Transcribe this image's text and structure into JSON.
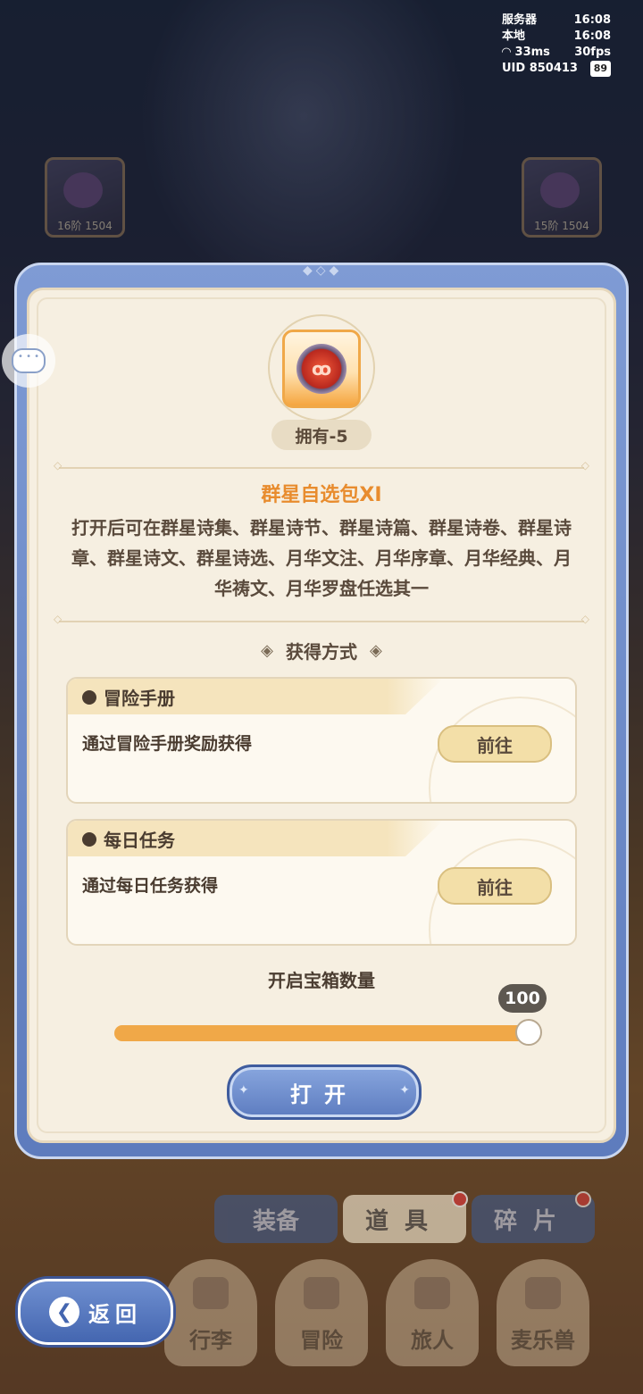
{
  "hud": {
    "server_label": "服务器",
    "server_time": "16:08",
    "local_label": "本地",
    "local_time": "16:08",
    "ping": "33ms",
    "fps": "30fps",
    "uid": "UID 850413",
    "battery": "89"
  },
  "relics": [
    {
      "stage": "16阶",
      "power": "1504"
    },
    {
      "stage": "15阶",
      "power": "1504"
    }
  ],
  "item": {
    "owned_label": "拥有-5",
    "name": "群星自选包XI",
    "description": "打开后可在群星诗集、群星诗节、群星诗篇、群星诗卷、群星诗章、群星诗文、群星诗选、月华文注、月华序章、月华经典、月华祷文、月华罗盘任选其一"
  },
  "sources": {
    "heading": "获得方式",
    "cards": [
      {
        "title": "冒险手册",
        "text": "通过冒险手册奖励获得",
        "button": "前往"
      },
      {
        "title": "每日任务",
        "text": "通过每日任务获得",
        "button": "前往"
      }
    ]
  },
  "quantity": {
    "label": "开启宝箱数量",
    "value": "100",
    "fill_fraction": 1.0
  },
  "open_button": "打开",
  "bottom_tabs": [
    {
      "label": "装备"
    },
    {
      "label": "道具"
    },
    {
      "label": "碎片"
    }
  ],
  "nav": [
    {
      "label": "行李"
    },
    {
      "label": "冒险"
    },
    {
      "label": "旅人"
    },
    {
      "label": "麦乐兽"
    }
  ],
  "back_button": "返回",
  "colors": {
    "accent": "#f0a848",
    "title": "#e88c2e",
    "frame": "#6f8fd0"
  }
}
